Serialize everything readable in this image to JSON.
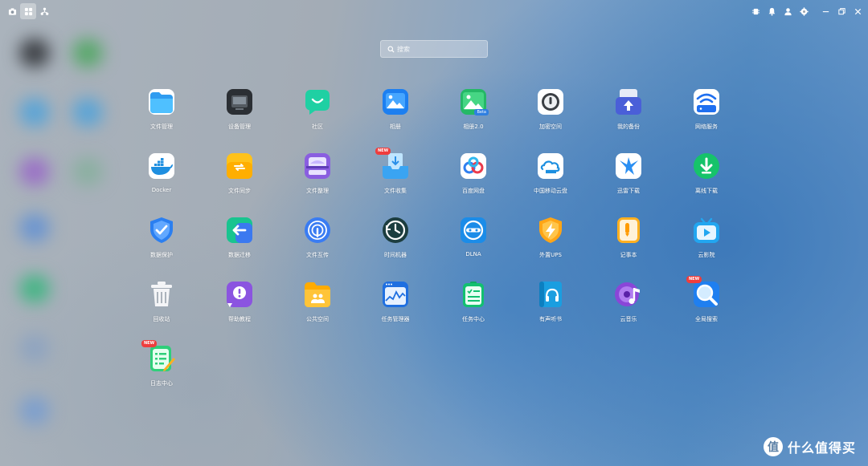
{
  "search": {
    "placeholder": "搜索"
  },
  "topbar": {
    "left": [
      {
        "name": "camera-icon",
        "active": false
      },
      {
        "name": "grid-apps-icon",
        "active": true
      },
      {
        "name": "network-nodes-icon",
        "active": false
      }
    ],
    "right": [
      "plugin-icon",
      "bell-icon",
      "user-icon",
      "gear-icon",
      "minimize-icon",
      "restore-icon",
      "close-icon"
    ]
  },
  "apps": [
    [
      {
        "label": "文件管理",
        "icon": "folder-icon"
      },
      {
        "label": "设备管理",
        "icon": "device-icon"
      },
      {
        "label": "社区",
        "icon": "community-chat-icon"
      },
      {
        "label": "相册",
        "icon": "photo-album-icon"
      },
      {
        "label": "相册2.0",
        "icon": "photo-album-2-icon",
        "badge": "Beta"
      },
      {
        "label": "加密空间",
        "icon": "encrypted-space-icon"
      },
      {
        "label": "我的备份",
        "icon": "backup-icon"
      },
      {
        "label": "网络服务",
        "icon": "network-service-icon"
      }
    ],
    [
      {
        "label": "Docker",
        "icon": "docker-icon"
      },
      {
        "label": "文件同步",
        "icon": "file-sync-icon"
      },
      {
        "label": "文件整理",
        "icon": "file-organize-icon"
      },
      {
        "label": "文件收集",
        "icon": "file-collect-icon",
        "badge": "NEW"
      },
      {
        "label": "百度网盘",
        "icon": "baidu-netdisk-icon"
      },
      {
        "label": "中国移动云盘",
        "icon": "china-mobile-cloud-icon"
      },
      {
        "label": "迅雷下载",
        "icon": "thunder-download-icon"
      },
      {
        "label": "离线下载",
        "icon": "offline-download-icon"
      }
    ],
    [
      {
        "label": "数据保护",
        "icon": "data-protection-icon"
      },
      {
        "label": "数据迁移",
        "icon": "data-migration-icon"
      },
      {
        "label": "文件互传",
        "icon": "file-transfer-icon"
      },
      {
        "label": "时间机器",
        "icon": "time-machine-icon"
      },
      {
        "label": "DLNA",
        "icon": "dlna-icon"
      },
      {
        "label": "外置UPS",
        "icon": "ups-icon"
      },
      {
        "label": "记事本",
        "icon": "notepad-icon"
      },
      {
        "label": "云影院",
        "icon": "cloud-cinema-icon"
      }
    ],
    [
      {
        "label": "回收站",
        "icon": "recycle-bin-icon"
      },
      {
        "label": "帮助教程",
        "icon": "help-tutorial-icon"
      },
      {
        "label": "公共空间",
        "icon": "public-space-icon"
      },
      {
        "label": "任务管理器",
        "icon": "task-manager-icon"
      },
      {
        "label": "任务中心",
        "icon": "task-center-icon"
      },
      {
        "label": "有声听书",
        "icon": "audiobook-icon"
      },
      {
        "label": "云音乐",
        "icon": "cloud-music-icon"
      },
      {
        "label": "全局搜索",
        "icon": "global-search-icon",
        "badge": "NEW"
      }
    ],
    [
      {
        "label": "日志中心",
        "icon": "log-center-icon",
        "badge": "NEW"
      }
    ]
  ],
  "watermark": {
    "mark": "值",
    "text": "什么值得买"
  }
}
